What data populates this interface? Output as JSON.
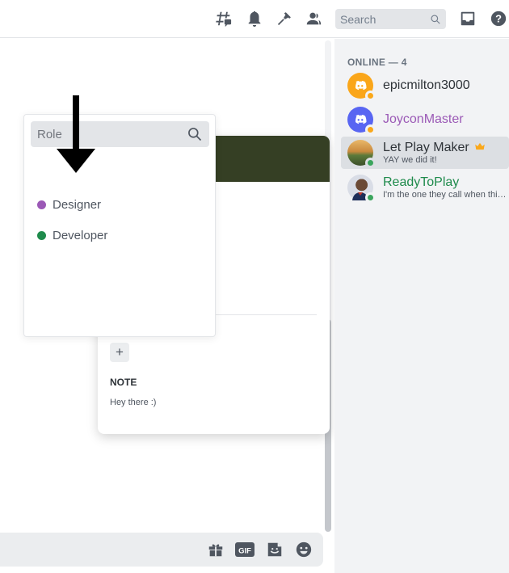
{
  "search": {
    "placeholder": "Search"
  },
  "members": {
    "header": "ONLINE — 4",
    "items": [
      {
        "name": "epicmilton3000",
        "subtitle": "",
        "color": "#4f5660"
      },
      {
        "name": "JoyconMaster",
        "subtitle": "",
        "color": "#9b59b6"
      },
      {
        "name": "Let Play Maker",
        "subtitle": "YAY we did it!",
        "color": "#2e3338",
        "badge": "crown-icon"
      },
      {
        "name": "ReadyToPlay",
        "subtitle": "I'm the one they call when thin...",
        "color": "#1f8b4c"
      }
    ]
  },
  "role_picker": {
    "placeholder": "Role",
    "roles": [
      {
        "name": "Designer",
        "color": "#9b59b6"
      },
      {
        "name": "Developer",
        "color": "#1f8b4c"
      }
    ]
  },
  "profile": {
    "add_role_label": "+",
    "note_label": "NOTE",
    "note_value": "Hey there :)"
  },
  "colors": {
    "banner": "#353f24",
    "online": "#3ba55d",
    "idle": "#faa81a",
    "accent": "#5865f2",
    "arrow": "#000000"
  }
}
